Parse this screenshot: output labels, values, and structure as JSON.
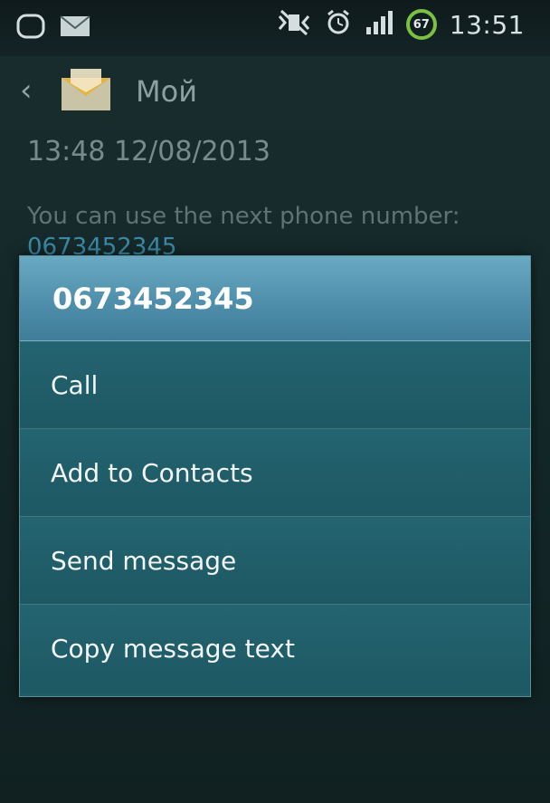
{
  "status_bar": {
    "time": "13:51",
    "battery_level": "67",
    "icons": [
      "notification-bubble-icon",
      "mail-icon",
      "mute-icon",
      "alarm-icon",
      "signal-icon",
      "battery-icon"
    ]
  },
  "header": {
    "title": "Мой"
  },
  "message": {
    "timestamp": "13:48  12/08/2013",
    "text": "You can use the next phone number:",
    "phone_link": "0673452345"
  },
  "context_menu": {
    "title": "0673452345",
    "items": [
      {
        "label": "Call"
      },
      {
        "label": "Add to Contacts"
      },
      {
        "label": "Send message"
      },
      {
        "label": "Copy message text"
      }
    ]
  },
  "colors": {
    "dialog_header": "#5a9ab4",
    "dialog_body": "#1f5c66",
    "battery_ring": "#7ac043"
  }
}
